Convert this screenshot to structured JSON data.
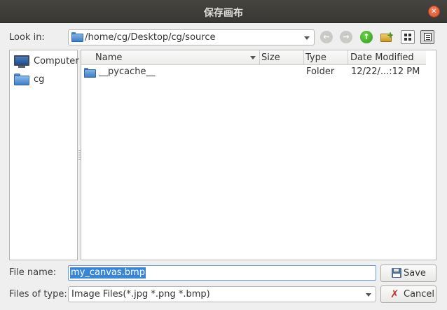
{
  "window": {
    "title": "保存画布",
    "close_glyph": "✕"
  },
  "toolbar": {
    "look_in_label": "Look in:",
    "path": "/home/cg/Desktop/cg/source",
    "back_glyph": "←",
    "forward_glyph": "→",
    "up_glyph": "↑",
    "new_folder_glyph": "+"
  },
  "sidebar": {
    "items": [
      {
        "label": "Computer",
        "icon": "computer-icon"
      },
      {
        "label": "cg",
        "icon": "folder-icon"
      }
    ]
  },
  "file_list": {
    "columns": [
      "Name",
      "Size",
      "Type",
      "Date Modified"
    ],
    "rows": [
      {
        "name": "__pycache__",
        "size": "",
        "type": "Folder",
        "date": "12/22/...:12 PM"
      }
    ]
  },
  "form": {
    "file_name_label": "File name:",
    "file_name_value": "my_canvas.bmp",
    "files_of_type_label": "Files of type:",
    "files_of_type_value": "Image Files(*.jpg *.png *.bmp)"
  },
  "buttons": {
    "save": "Save",
    "cancel": "Cancel"
  },
  "colors": {
    "accent": "#3a86d6",
    "titlebar": "#3f3e3a",
    "close": "#e5653e"
  }
}
